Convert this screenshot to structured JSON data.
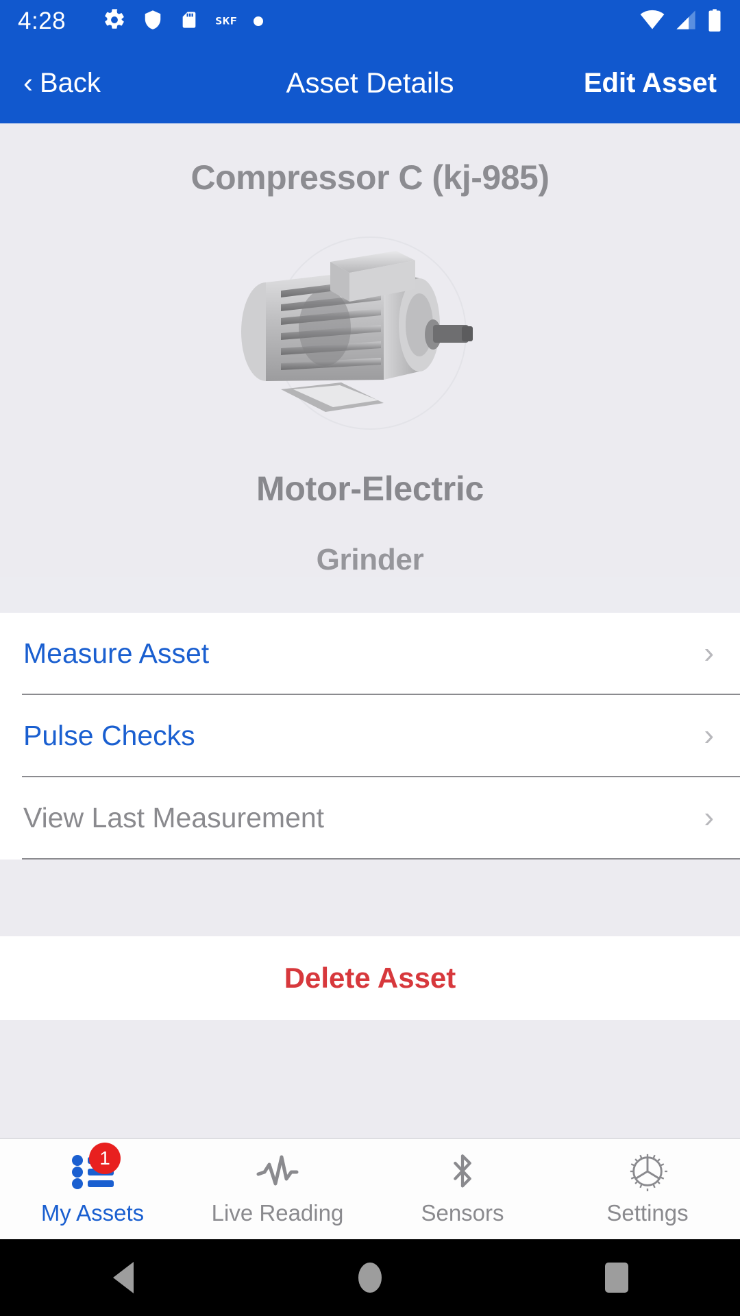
{
  "status_bar": {
    "time": "4:28",
    "icons": [
      "gear-icon",
      "shield-icon",
      "sd-card-icon",
      "skf-logo",
      "dot-icon"
    ],
    "brand_text": "SKF",
    "right_icons": [
      "wifi-icon",
      "cellular-signal-icon",
      "battery-icon"
    ]
  },
  "nav": {
    "back_label": "Back",
    "back_chevron": "‹",
    "title": "Asset Details",
    "edit_label": "Edit Asset"
  },
  "hero": {
    "asset_title": "Compressor C (kj-985)",
    "asset_image": "electric-motor-render",
    "asset_type": "Motor-Electric",
    "asset_subtype": "Grinder"
  },
  "list": {
    "chevron": "›",
    "rows": [
      {
        "label": "Measure Asset",
        "state": "enabled"
      },
      {
        "label": "Pulse Checks",
        "state": "enabled"
      },
      {
        "label": "View Last Measurement",
        "state": "disabled"
      }
    ]
  },
  "delete": {
    "label": "Delete Asset"
  },
  "tabs": [
    {
      "label": "My Assets",
      "icon": "bulleted-list-icon",
      "active": true,
      "badge": "1"
    },
    {
      "label": "Live Reading",
      "icon": "waveform-icon",
      "active": false,
      "badge": ""
    },
    {
      "label": "Sensors",
      "icon": "bluetooth-icon",
      "active": false,
      "badge": ""
    },
    {
      "label": "Settings",
      "icon": "gear-icon",
      "active": false,
      "badge": ""
    }
  ],
  "android_nav": {
    "back": "back-triangle-icon",
    "home": "home-circle-icon",
    "recents": "recents-square-icon"
  },
  "colors": {
    "brand_blue": "#1158CE",
    "link_blue": "#1A5FD0",
    "danger_red": "#D7383C",
    "badge_red": "#E8201F",
    "page_bg": "#ECEBF0",
    "muted_text": "#8A8A8E"
  }
}
